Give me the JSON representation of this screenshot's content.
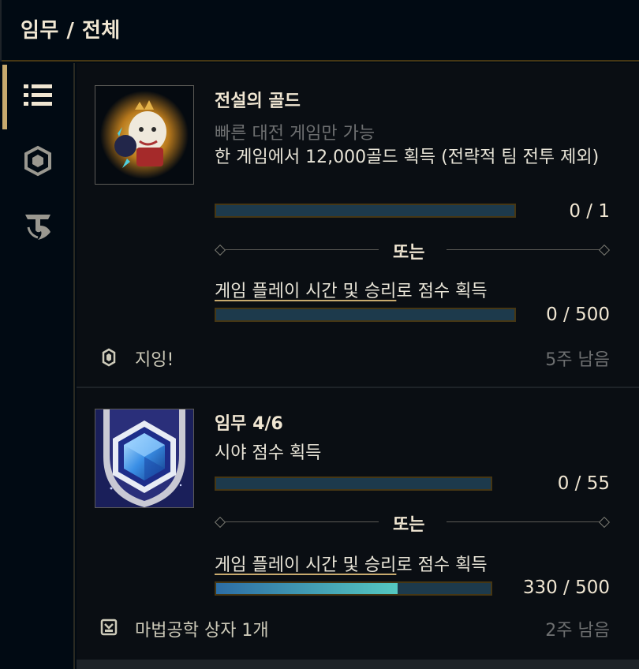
{
  "header": {
    "title": "임무 / 전체"
  },
  "sidebar": {
    "items": [
      {
        "icon": "list-icon",
        "active": true
      },
      {
        "icon": "hexagon-icon",
        "active": false
      },
      {
        "icon": "tft-icon",
        "active": false
      }
    ]
  },
  "missions": [
    {
      "name": "전설의 골드",
      "restriction": "빠른 대전 게임만 가능",
      "objective": "한 게임에서 12,000골드 획득 (전략적 팀 전투 제외)",
      "progress_text": "0 / 1",
      "progress": 0,
      "or_label": "또는",
      "alt_link": "게임 플레이 시간 및 승리",
      "alt_suffix": "로 점수 획득",
      "alt_progress_text": "0 / 500",
      "alt_progress": 0,
      "reward": "지잉!",
      "reward_icon": "emote-icon",
      "time_left": "5주 남음"
    },
    {
      "name": "임무 4/6",
      "objective": "시야 점수 획득",
      "progress_text": "0 / 55",
      "progress": 0,
      "or_label": "또는",
      "alt_link": "게임 플레이 시간 및 승리",
      "alt_suffix": "로 점수 획득",
      "alt_progress_text": "330 / 500",
      "alt_progress": 0.66,
      "reward": "마법공학 상자 1개",
      "reward_icon": "chest-icon",
      "time_left": "2주 남음"
    }
  ],
  "colors": {
    "gold": "#c8aa6e",
    "bar_fill_start": "#2d6da4",
    "bar_fill_end": "#55c8c0"
  }
}
